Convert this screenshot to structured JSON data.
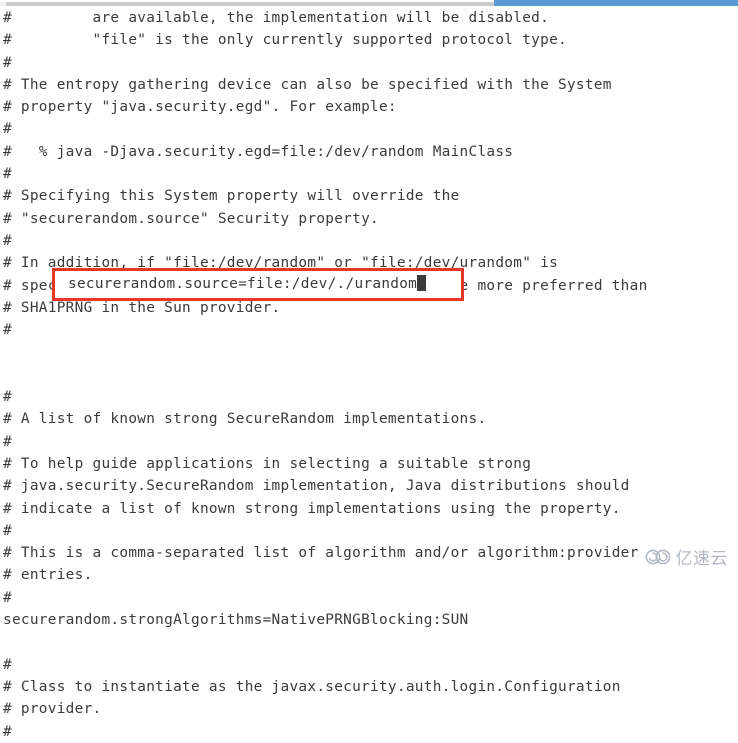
{
  "scrollbar": {
    "name": "horizontal-scrollbar",
    "track_color": "#f1f1f1",
    "thumb_color": "#c9c9c9",
    "accent_color": "#5b9bd5"
  },
  "editor": {
    "background": "#ffffff",
    "text_color": "#3b3b3b",
    "lines": [
      "#         are available, the implementation will be disabled.",
      "#         \"file\" is the only currently supported protocol type.",
      "#",
      "# The entropy gathering device can also be specified with the System",
      "# property \"java.security.egd\". For example:",
      "#",
      "#   % java -Djava.security.egd=file:/dev/random MainClass",
      "#",
      "# Specifying this System property will override the",
      "# \"securerandom.source\" Security property.",
      "#",
      "# In addition, if \"file:/dev/random\" or \"file:/dev/urandom\" is",
      "# specified, the \"NativePRNG\" implementation will be more preferred than",
      "# SHA1PRNG in the Sun provider.",
      "#",
      "",
      "",
      "#",
      "# A list of known strong SecureRandom implementations.",
      "#",
      "# To help guide applications in selecting a suitable strong",
      "# java.security.SecureRandom implementation, Java distributions should",
      "# indicate a list of known strong implementations using the property.",
      "#",
      "# This is a comma-separated list of algorithm and/or algorithm:provider",
      "# entries.",
      "#",
      "securerandom.strongAlgorithms=NativePRNGBlocking:SUN",
      "",
      "#",
      "# Class to instantiate as the javax.security.auth.login.Configuration",
      "# provider.",
      "#"
    ]
  },
  "highlight": {
    "name": "highlighted-property-line",
    "border_color": "#e8362a",
    "text": "securerandom.source=file:/dev/./urandom",
    "caret_visible": true
  },
  "watermark": {
    "text": "亿速云",
    "color": "#9aa2b1",
    "icon": "cloud-spiral-icon"
  }
}
